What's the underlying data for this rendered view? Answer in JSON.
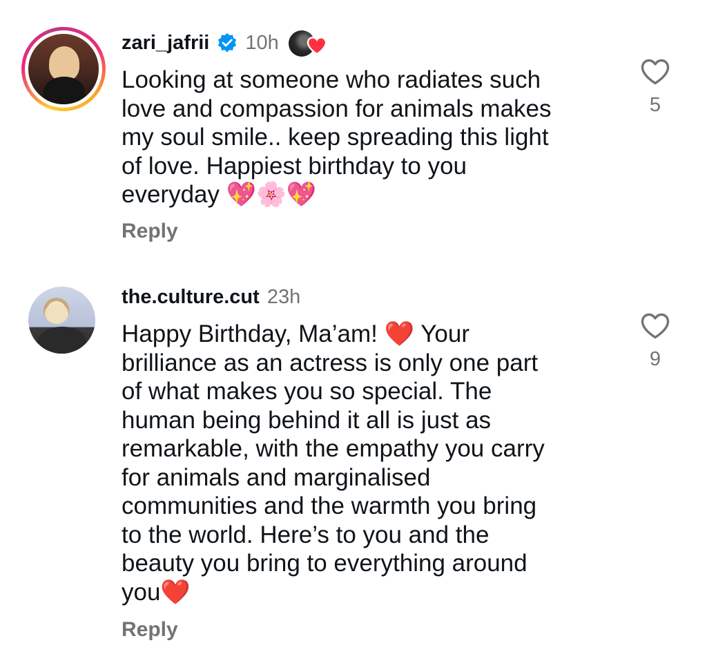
{
  "comments": [
    {
      "username": "zari_jafrii",
      "verified": true,
      "timestamp": "10h",
      "text": "Looking at someone who radiates such\nlove and compassion for animals makes\nmy soul smile.. keep spreading this light\nof love. Happiest birthday to you\neveryday 💖🌸💖",
      "reply_label": "Reply",
      "like_count": "5",
      "liked_by_author": true
    },
    {
      "username": "the.culture.cut",
      "verified": false,
      "timestamp": "23h",
      "text": "Happy Birthday, Ma’am! ❤️ Your\nbrilliance as an actress is only one part\nof what makes you so special. The\nhuman being behind it all is just as\nremarkable, with the empathy you carry\nfor animals and marginalised\ncommunities and the warmth you bring\nto the world. Here’s to you and the\nbeauty you bring to everything around\nyou❤️",
      "reply_label": "Reply",
      "like_count": "9",
      "liked_by_author": false
    }
  ],
  "colors": {
    "text_primary": "#0f1419",
    "text_secondary": "#737373",
    "verified_blue": "#0095f6",
    "heart_red": "#ff3040"
  },
  "icons": {
    "verified": "verified-badge-icon",
    "like": "heart-outline-icon",
    "liked_by": "heart-filled-icon"
  }
}
